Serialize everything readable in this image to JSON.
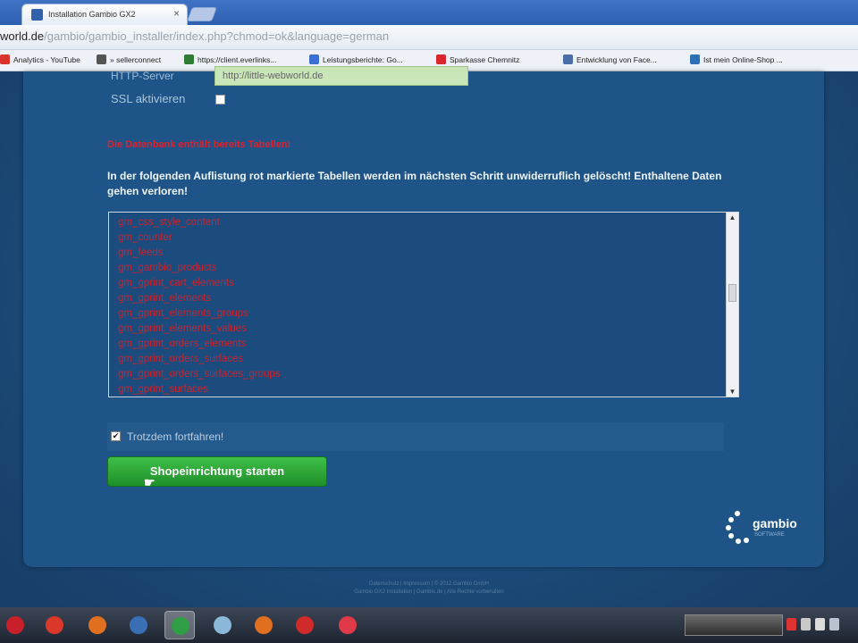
{
  "browser": {
    "tab_title": "Installation Gambio GX2",
    "tab_close": "×",
    "url_host": "world.de",
    "url_path": "/gambio/gambio_installer/index.php?chmod=ok&language=german",
    "bookmarks": [
      {
        "label": "Analytics - YouTube",
        "icon": "analytics-icon",
        "color": "#d9342b"
      },
      {
        "label": "» sellerconnect",
        "icon": "sellerconnect-icon",
        "color": "#555555"
      },
      {
        "label": "https://client.everlinks...",
        "icon": "everlinks-icon",
        "color": "#2e7d32"
      },
      {
        "label": "Leistungsberichte: Go...",
        "icon": "google-ads-icon",
        "color": "#3b6fd1"
      },
      {
        "label": "Sparkasse Chemnitz",
        "icon": "sparkasse-icon",
        "color": "#d9252c"
      },
      {
        "label": "Entwicklung von Face...",
        "icon": "facebook-stats-icon",
        "color": "#4a6ea8"
      },
      {
        "label": "Ist mein Online-Shop ...",
        "icon": "chat-bubble-icon",
        "color": "#2f6fb5"
      }
    ]
  },
  "form": {
    "server_label": "HTTP-Server",
    "server_value": "http://little-webworld.de",
    "ssl_label": "SSL aktivieren",
    "ssl_checked": false
  },
  "warning": {
    "title": "Die Datenbank enthält bereits Tabellen!",
    "text": "In der folgenden Auflistung rot markierte Tabellen werden im nächsten Schritt unwiderruflich gelöscht! Enthaltene Daten gehen verloren!"
  },
  "tables": [
    "gm_css_style_content",
    "gm_counter",
    "gm_feeds",
    "gm_gambio_products",
    "gm_gprint_cart_elements",
    "gm_gprint_elements",
    "gm_gprint_elements_groups",
    "gm_gprint_elements_values",
    "gm_gprint_orders_elements",
    "gm_gprint_orders_surfaces",
    "gm_gprint_orders_surfaces_groups",
    "gm_gprint_surfaces"
  ],
  "scrollbar": {
    "up": "▲",
    "down": "▼"
  },
  "continue": {
    "label": "Trotzdem fortfahren!",
    "checked": true,
    "mark": "✔"
  },
  "start_button": "Shopeinrichtung starten",
  "logo": {
    "text": "gambio",
    "sub": "SOFTWARE"
  },
  "footer": {
    "line1": "Datenschutz | Impressum | © 2012 Gambio GmbH",
    "line2": "Gambio GX2 Installation | Gambio.de | Alle Rechte vorbehalten"
  },
  "taskbar": [
    {
      "icon": "filezilla-icon",
      "color": "#c8202a"
    },
    {
      "icon": "media-player-icon",
      "color": "#d9382b"
    },
    {
      "icon": "firefox-icon",
      "color": "#e0701f"
    },
    {
      "icon": "thunderbird-icon",
      "color": "#3a6fb6"
    },
    {
      "icon": "chrome-icon",
      "color": "#2f9e44",
      "active": true
    },
    {
      "icon": "paint-icon",
      "color": "#8bb7d8"
    },
    {
      "icon": "firefox-icon",
      "color": "#e0701f"
    },
    {
      "icon": "acrobat-icon",
      "color": "#d02a2a"
    },
    {
      "icon": "recorder-icon",
      "color": "#e03a4a"
    }
  ]
}
